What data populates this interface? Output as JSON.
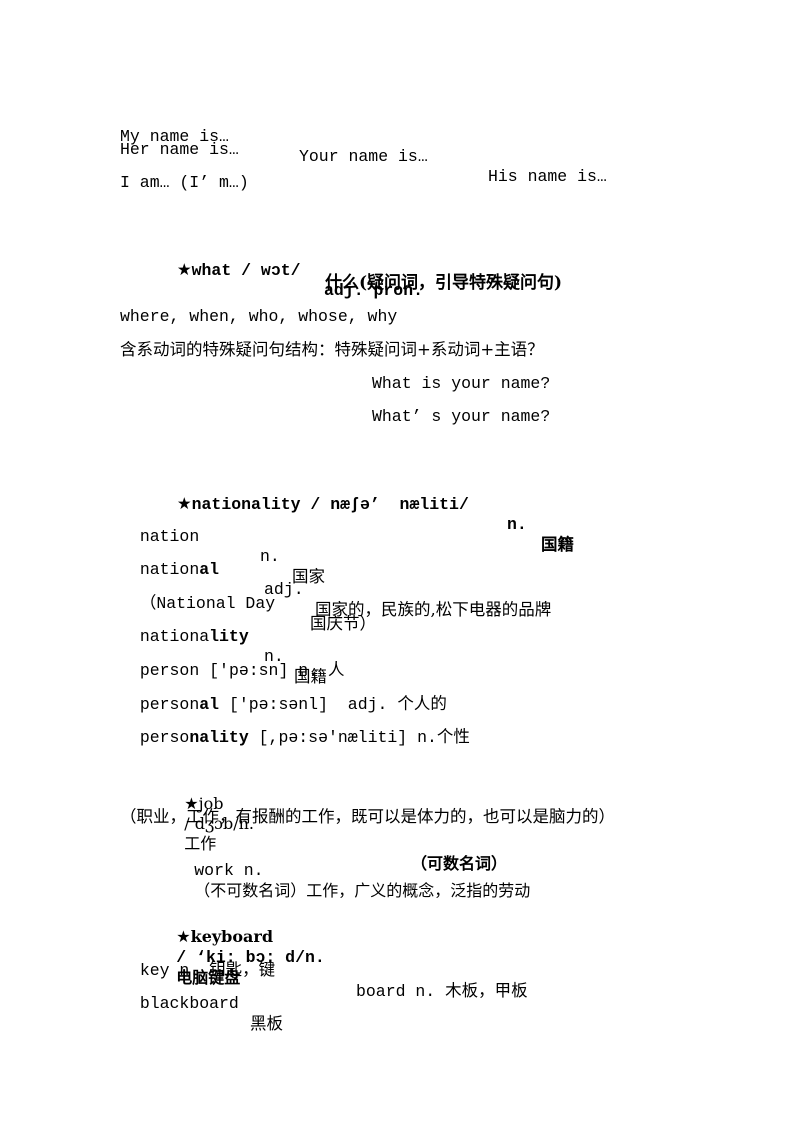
{
  "intro": {
    "line1": {
      "a": "My name is…",
      "b": "Your name is…",
      "c": "His name is…"
    },
    "line2": "Her name is…",
    "line3": "I am… (I’ m…)"
  },
  "what": {
    "star": "★",
    "word": "what",
    "phonetic": " / wɔt/",
    "pos": "adj. pron.",
    "meaning": "什么(疑问词，引导特殊疑问句)",
    "related": "where, when, who, whose, why",
    "structure": "含系动词的特殊疑问句结构：特殊疑问词+系动词+主语？",
    "example1": "What is your name?",
    "example2": "What’ s your name?"
  },
  "nationality": {
    "star": "★",
    "word": "nationality",
    "phonetic": " / næʃə’  næliti/",
    "pos": "n.",
    "meaning": "国籍",
    "entries": [
      {
        "stem": "nation",
        "suffix": "",
        "pos": "n.",
        "meaning": "国家"
      },
      {
        "stem": "nation",
        "suffix": "al",
        "pos": "adj.",
        "meaning": "国家的，民族的,松下电器的品牌"
      },
      {
        "stem": "nationa",
        "suffix": "lity",
        "pos": "n.",
        "meaning": "国籍"
      },
      {
        "stem": "person",
        "suffix": "",
        "phonetic": "['pə:sn]",
        "pos": "n.",
        "meaning": "人"
      },
      {
        "stem": "person",
        "suffix": "al",
        "phonetic": "['pə:sənl]",
        "pos": "adj.",
        "meaning": "个人的"
      },
      {
        "stem": "perso",
        "suffix": "nality",
        "phonetic": "[,pə:sə'næliti]",
        "pos": "n.",
        "meaning": "个性"
      }
    ],
    "national_day": {
      "open": "（",
      "en": "National Day",
      "cn": "国庆节）"
    }
  },
  "job": {
    "star": "★",
    "word": "job",
    "phonetic": "/ dʒɔb/n.",
    "meaning": "工作",
    "note": "（可数名词）",
    "explanation": "（职业，工作，有报酬的工作，既可以是体力的，也可以是脑力的）",
    "work_word": "work n.",
    "work_meaning": "（不可数名词）工作，广义的概念，泛指的劳动"
  },
  "keyboard": {
    "star": "★",
    "word": "keyboard",
    "phonetic": "/ ‘ki: bɔ: d/n.",
    "meaning": "电脑键盘",
    "key": {
      "word": "key n.",
      "meaning": "钥匙，键"
    },
    "board": {
      "word": "board n.",
      "meaning": "木板，甲板"
    },
    "blackboard": {
      "word": "blackboard",
      "meaning": "黑板"
    }
  }
}
